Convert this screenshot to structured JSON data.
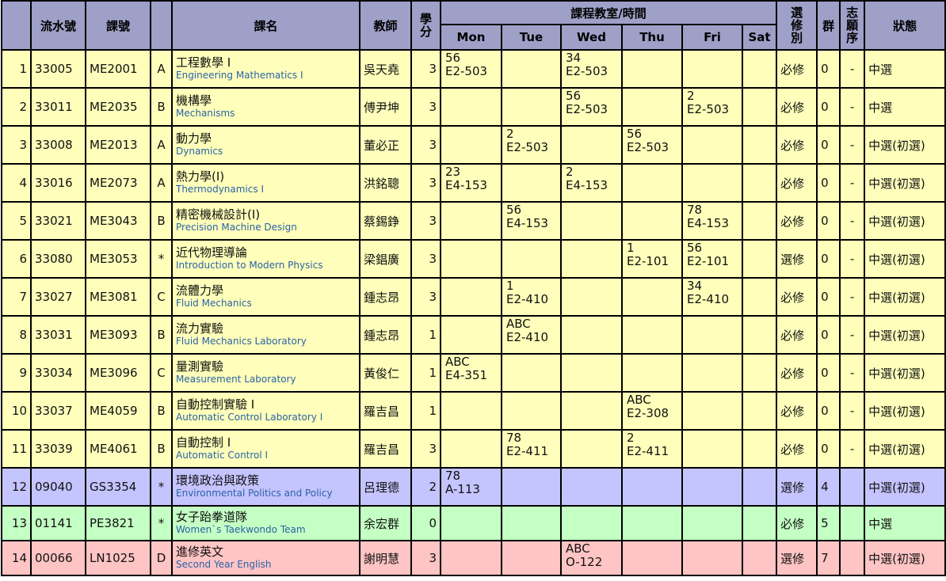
{
  "headers": {
    "serial": "流水號",
    "code": "課號",
    "name": "課名",
    "teacher": "教師",
    "credits": [
      "學",
      "分"
    ],
    "schedule": "課程教室/時間",
    "days": [
      "Mon",
      "Tue",
      "Wed",
      "Thu",
      "Fri",
      "Sat"
    ],
    "type": [
      "選",
      "修",
      "別"
    ],
    "group": "群",
    "priority": [
      "志",
      "願",
      "序"
    ],
    "status": "狀態"
  },
  "rows": [
    {
      "no": "1",
      "serial": "33005",
      "code": "ME2001",
      "cls": "A",
      "zh": "工程數學 Ⅰ",
      "en": "Engineering Mathematics Ⅰ",
      "teacher": "吳天堯",
      "credits": "3",
      "mon": [
        "56",
        "E2-503"
      ],
      "tue": [
        "",
        ""
      ],
      "wed": [
        "34",
        "E2-503"
      ],
      "thu": [
        "",
        ""
      ],
      "fri": [
        "",
        ""
      ],
      "type": "必修",
      "group": "0",
      "priority": "-",
      "status": "中選",
      "color": "yellow"
    },
    {
      "no": "2",
      "serial": "33011",
      "code": "ME2035",
      "cls": "B",
      "zh": "機構學",
      "en": "Mechanisms",
      "teacher": "傅尹坤",
      "credits": "3",
      "mon": [
        "",
        ""
      ],
      "tue": [
        "",
        ""
      ],
      "wed": [
        "56",
        "E2-503"
      ],
      "thu": [
        "",
        ""
      ],
      "fri": [
        "2",
        "E2-503"
      ],
      "type": "必修",
      "group": "0",
      "priority": "-",
      "status": "中選",
      "color": "yellow"
    },
    {
      "no": "3",
      "serial": "33008",
      "code": "ME2013",
      "cls": "A",
      "zh": "動力學",
      "en": "Dynamics",
      "teacher": "董必正",
      "credits": "3",
      "mon": [
        "",
        ""
      ],
      "tue": [
        "2",
        "E2-503"
      ],
      "wed": [
        "",
        ""
      ],
      "thu": [
        "56",
        "E2-503"
      ],
      "fri": [
        "",
        ""
      ],
      "type": "必修",
      "group": "0",
      "priority": "-",
      "status": "中選(初選)",
      "color": "yellow"
    },
    {
      "no": "4",
      "serial": "33016",
      "code": "ME2073",
      "cls": "A",
      "zh": "熱力學(I)",
      "en": "Thermodynamics I",
      "teacher": "洪銘聰",
      "credits": "3",
      "mon": [
        "23",
        "E4-153"
      ],
      "tue": [
        "",
        ""
      ],
      "wed": [
        "2",
        "E4-153"
      ],
      "thu": [
        "",
        ""
      ],
      "fri": [
        "",
        ""
      ],
      "type": "必修",
      "group": "0",
      "priority": "-",
      "status": "中選(初選)",
      "color": "yellow"
    },
    {
      "no": "5",
      "serial": "33021",
      "code": "ME3043",
      "cls": "B",
      "zh": "精密機械設計(I)",
      "en": "Precision Machine Design",
      "teacher": "蔡錫錚",
      "credits": "3",
      "mon": [
        "",
        ""
      ],
      "tue": [
        "56",
        "E4-153"
      ],
      "wed": [
        "",
        ""
      ],
      "thu": [
        "",
        ""
      ],
      "fri": [
        "78",
        "E4-153"
      ],
      "type": "必修",
      "group": "0",
      "priority": "-",
      "status": "中選(初選)",
      "color": "yellow"
    },
    {
      "no": "6",
      "serial": "33080",
      "code": "ME3053",
      "cls": "*",
      "zh": "近代物理導論",
      "en": "Introduction to Modern Physics",
      "teacher": "梁錩廣",
      "credits": "3",
      "mon": [
        "",
        ""
      ],
      "tue": [
        "",
        ""
      ],
      "wed": [
        "",
        ""
      ],
      "thu": [
        "1",
        "E2-101"
      ],
      "fri": [
        "56",
        "E2-101"
      ],
      "type": "選修",
      "group": "0",
      "priority": "-",
      "status": "中選(初選)",
      "color": "yellow"
    },
    {
      "no": "7",
      "serial": "33027",
      "code": "ME3081",
      "cls": "C",
      "zh": "流體力學",
      "en": "Fluid Mechanics",
      "teacher": "鍾志昂",
      "credits": "3",
      "mon": [
        "",
        ""
      ],
      "tue": [
        "1",
        "E2-410"
      ],
      "wed": [
        "",
        ""
      ],
      "thu": [
        "",
        ""
      ],
      "fri": [
        "34",
        "E2-410"
      ],
      "type": "必修",
      "group": "0",
      "priority": "-",
      "status": "中選(初選)",
      "color": "yellow"
    },
    {
      "no": "8",
      "serial": "33031",
      "code": "ME3093",
      "cls": "B",
      "zh": "流力實驗",
      "en": "Fluid Mechanics Laboratory",
      "teacher": "鍾志昂",
      "credits": "1",
      "mon": [
        "",
        ""
      ],
      "tue": [
        "ABC",
        "E2-410"
      ],
      "wed": [
        "",
        ""
      ],
      "thu": [
        "",
        ""
      ],
      "fri": [
        "",
        ""
      ],
      "type": "必修",
      "group": "0",
      "priority": "-",
      "status": "中選(初選)",
      "color": "yellow"
    },
    {
      "no": "9",
      "serial": "33034",
      "code": "ME3096",
      "cls": "C",
      "zh": "量測實驗",
      "en": "Measurement Laboratory",
      "teacher": "黃俊仁",
      "credits": "1",
      "mon": [
        "ABC",
        "E4-351"
      ],
      "tue": [
        "",
        ""
      ],
      "wed": [
        "",
        ""
      ],
      "thu": [
        "",
        ""
      ],
      "fri": [
        "",
        ""
      ],
      "type": "必修",
      "group": "0",
      "priority": "-",
      "status": "中選(初選)",
      "color": "yellow"
    },
    {
      "no": "10",
      "serial": "33037",
      "code": "ME4059",
      "cls": "B",
      "zh": "自動控制實驗 Ⅰ",
      "en": "Automatic Control Laboratory I",
      "teacher": "羅吉昌",
      "credits": "1",
      "mon": [
        "",
        ""
      ],
      "tue": [
        "",
        ""
      ],
      "wed": [
        "",
        ""
      ],
      "thu": [
        "ABC",
        "E2-308"
      ],
      "fri": [
        "",
        ""
      ],
      "type": "必修",
      "group": "0",
      "priority": "-",
      "status": "中選(初選)",
      "color": "yellow"
    },
    {
      "no": "11",
      "serial": "33039",
      "code": "ME4061",
      "cls": "B",
      "zh": "自動控制 I",
      "en": "Automatic Control I",
      "teacher": "羅吉昌",
      "credits": "3",
      "mon": [
        "",
        ""
      ],
      "tue": [
        "78",
        "E2-411"
      ],
      "wed": [
        "",
        ""
      ],
      "thu": [
        "2",
        "E2-411"
      ],
      "fri": [
        "",
        ""
      ],
      "type": "必修",
      "group": "0",
      "priority": "-",
      "status": "中選(初選)",
      "color": "yellow"
    },
    {
      "no": "12",
      "serial": "09040",
      "code": "GS3354",
      "cls": "*",
      "zh": "環境政治與政策",
      "en": "Environmental Politics and Policy",
      "teacher": "呂理德",
      "credits": "2",
      "mon": [
        "78",
        "A-113"
      ],
      "tue": [
        "",
        ""
      ],
      "wed": [
        "",
        ""
      ],
      "thu": [
        "",
        ""
      ],
      "fri": [
        "",
        ""
      ],
      "type": "選修",
      "group": "4",
      "priority": "",
      "status": "中選(初選)",
      "color": "purple"
    },
    {
      "no": "13",
      "serial": "01141",
      "code": "PE3821",
      "cls": "*",
      "zh": "女子跆拳道隊",
      "en": "Women`s Taekwondo Team",
      "teacher": "余宏群",
      "credits": "0",
      "mon": [
        "",
        ""
      ],
      "tue": [
        "",
        ""
      ],
      "wed": [
        "",
        ""
      ],
      "thu": [
        "",
        ""
      ],
      "fri": [
        "",
        ""
      ],
      "type": "必修",
      "group": "5",
      "priority": "",
      "status": "中選",
      "color": "green"
    },
    {
      "no": "14",
      "serial": "00066",
      "code": "LN1025",
      "cls": "D",
      "zh": "進修英文",
      "en": "Second Year English",
      "teacher": "謝明慧",
      "credits": "3",
      "mon": [
        "",
        ""
      ],
      "tue": [
        "",
        ""
      ],
      "wed": [
        "ABC",
        "O-122"
      ],
      "thu": [
        "",
        ""
      ],
      "fri": [
        "",
        ""
      ],
      "type": "選修",
      "group": "7",
      "priority": "",
      "status": "中選(初選)",
      "color": "pink"
    }
  ]
}
